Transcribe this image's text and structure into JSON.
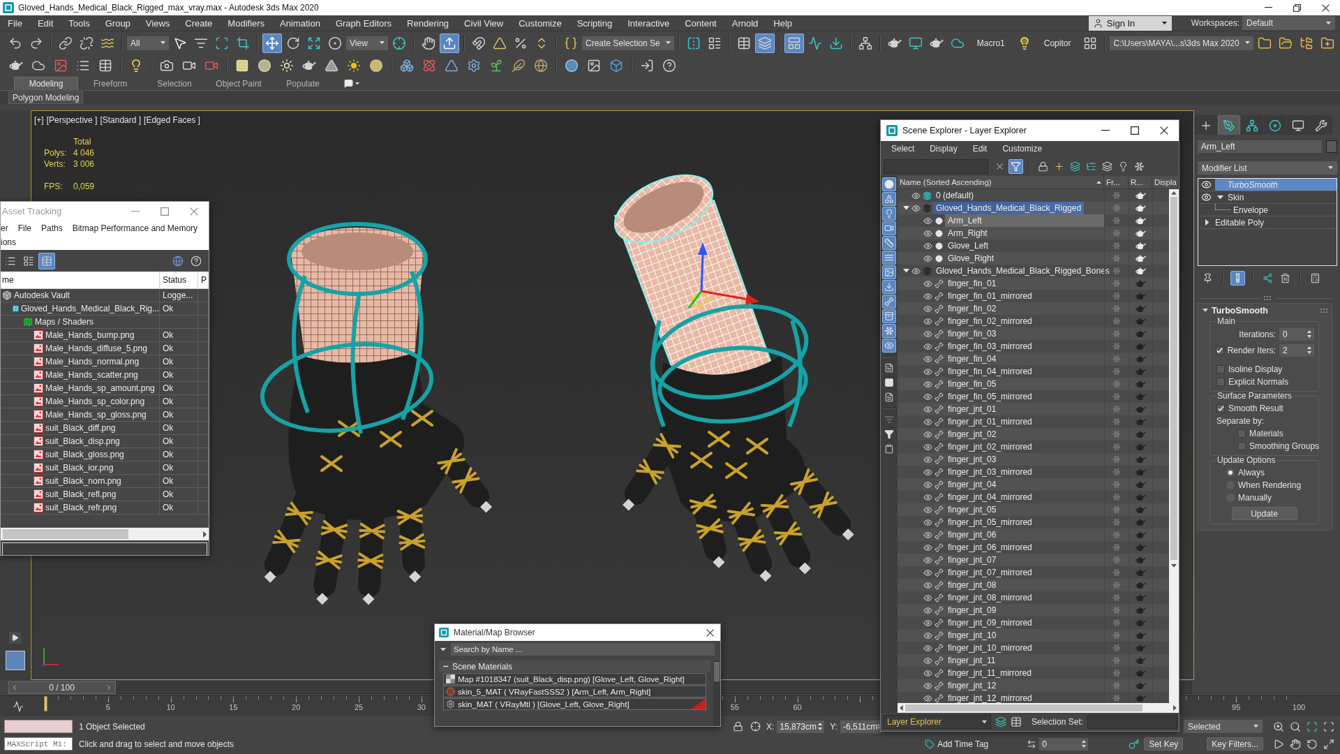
{
  "window": {
    "title": "Gloved_Hands_Medical_Black_Rigged_max_vray.max - Autodesk 3ds Max 2020"
  },
  "menu": [
    "File",
    "Edit",
    "Tools",
    "Group",
    "Views",
    "Create",
    "Modifiers",
    "Animation",
    "Graph Editors",
    "Rendering",
    "Civil View",
    "Customize",
    "Scripting",
    "Interactive",
    "Content",
    "Arnold",
    "Help"
  ],
  "account": {
    "sign_in": "Sign In",
    "workspaces_label": "Workspaces:",
    "workspace": "Default"
  },
  "main_toolbar": [
    [
      {
        "kind": "undo",
        "on": false
      },
      {
        "kind": "redo",
        "on": false
      }
    ],
    [
      {
        "kind": "link",
        "on": false
      },
      {
        "kind": "unlink",
        "on": false
      },
      {
        "kind": "bind",
        "on": false
      }
    ],
    [
      {
        "kind": "dropdown",
        "value": "All"
      },
      {
        "kind": "select",
        "on": false
      },
      {
        "kind": "byname",
        "on": false
      },
      {
        "kind": "region",
        "on": false
      },
      {
        "kind": "crossing",
        "on": false
      }
    ],
    [
      {
        "kind": "move",
        "on": true
      },
      {
        "kind": "rotate",
        "on": false
      },
      {
        "kind": "scale",
        "on": false
      },
      {
        "kind": "place",
        "on": false
      },
      {
        "kind": "dropdown",
        "value": "View"
      },
      {
        "kind": "pivot",
        "on": false
      }
    ],
    [
      {
        "kind": "manipulate",
        "on": false
      },
      {
        "kind": "override",
        "on": true
      }
    ],
    [
      {
        "kind": "snap",
        "on": false
      },
      {
        "kind": "angle",
        "on": false
      },
      {
        "kind": "percent",
        "on": false
      },
      {
        "kind": "spinner",
        "on": false
      }
    ],
    [
      {
        "kind": "named",
        "on": false
      },
      {
        "kind": "dropdown",
        "value": "Create Selection Se"
      }
    ],
    [
      {
        "kind": "mirror",
        "on": false
      },
      {
        "kind": "align",
        "on": false
      }
    ],
    [
      {
        "kind": "explorer",
        "on": false
      },
      {
        "kind": "layers",
        "on": true
      }
    ],
    [
      {
        "kind": "ribbon",
        "on": true
      },
      {
        "kind": "curves",
        "on": false
      },
      {
        "kind": "schematic",
        "on": false
      }
    ],
    [
      {
        "kind": "nodes",
        "on": false
      }
    ],
    [
      {
        "kind": "setup",
        "on": false
      },
      {
        "kind": "framewindow",
        "on": false
      },
      {
        "kind": "render",
        "on": false
      },
      {
        "kind": "cloudrender",
        "on": false
      },
      {
        "kind": "label",
        "text": "Macro1"
      },
      {
        "kind": "bulb",
        "on": false
      },
      {
        "kind": "label",
        "text": "Copitor"
      },
      {
        "kind": "grid",
        "on": false
      }
    ],
    [
      {
        "kind": "dropdown",
        "value": "C:\\Users\\MAYA\\...s\\3ds Max 2020"
      },
      {
        "kind": "project",
        "on": false
      },
      {
        "kind": "projectopen",
        "on": false
      },
      {
        "kind": "projecttree",
        "on": false
      },
      {
        "kind": "projectadd",
        "on": false
      }
    ]
  ],
  "secondary_toolbar": [
    [
      {
        "kind": "teapot",
        "on": false
      },
      {
        "kind": "cloud",
        "on": false
      },
      {
        "kind": "imagewindow",
        "on": false
      },
      {
        "kind": "list",
        "on": false
      },
      {
        "kind": "table",
        "on": false
      }
    ],
    [
      {
        "kind": "lightsign",
        "on": false
      }
    ],
    [
      {
        "kind": "camera",
        "on": false
      },
      {
        "kind": "video",
        "on": false
      },
      {
        "kind": "redcamera",
        "on": false
      }
    ],
    [
      {
        "kind": "plane",
        "on": false
      },
      {
        "kind": "dome",
        "on": false
      },
      {
        "kind": "glow",
        "on": false
      },
      {
        "kind": "teapot",
        "on": false
      },
      {
        "kind": "cone",
        "on": false
      },
      {
        "kind": "sun",
        "on": false
      },
      {
        "kind": "sphere",
        "on": false
      }
    ],
    [
      {
        "kind": "cubes",
        "on": false
      },
      {
        "kind": "molecule",
        "on": false
      },
      {
        "kind": "pyramid",
        "on": false
      },
      {
        "kind": "blob",
        "on": false
      },
      {
        "kind": "grass",
        "on": false
      },
      {
        "kind": "hair",
        "on": false
      },
      {
        "kind": "fur",
        "on": false
      }
    ],
    [
      {
        "kind": "ball",
        "on": false
      },
      {
        "kind": "renderimage",
        "on": false
      },
      {
        "kind": "cube",
        "on": false
      }
    ],
    [
      {
        "kind": "device",
        "on": false
      },
      {
        "kind": "help",
        "on": false
      }
    ]
  ],
  "ribbon": {
    "tabs": [
      {
        "label": "Modeling",
        "selected": true
      },
      {
        "label": "Freeform",
        "selected": false
      },
      {
        "label": "Selection",
        "selected": false
      },
      {
        "label": "Object Paint",
        "selected": false
      },
      {
        "label": "Populate",
        "selected": false
      }
    ],
    "panel": "Polygon Modeling"
  },
  "viewport": {
    "labels": [
      "[+]",
      "[Perspective ]",
      "[Standard ]",
      "[Edged Faces ]"
    ],
    "stats": {
      "heading": "Total",
      "rows": [
        {
          "kind": "count",
          "label": "Polys:",
          "value": "4 046"
        },
        {
          "kind": "count",
          "label": "Verts:",
          "value": "3 006"
        },
        {
          "kind": "rate",
          "label": "FPS:",
          "value": "0,059"
        }
      ]
    }
  },
  "asset_tracking": {
    "title": "Asset Tracking",
    "menu": [
      "er",
      "File",
      "Paths",
      "Bitmap Performance and Memory",
      "ions"
    ],
    "toolbar": [
      [
        {
          "kind": "list",
          "on": false
        },
        {
          "kind": "thumbnails",
          "on": false
        },
        {
          "kind": "table",
          "on": true
        }
      ],
      [
        {
          "kind": "globehelp",
          "on": false
        },
        {
          "kind": "help",
          "on": false
        }
      ]
    ],
    "columns": [
      "me",
      "Status",
      "P"
    ],
    "tree": [
      {
        "name": "Autodesk Vault",
        "kind": "vault",
        "status": "Logge...",
        "children": [
          {
            "name": "Gloved_Hands_Medical_Black_Rig...",
            "kind": "scene",
            "status": "Ok",
            "children": [
              {
                "name": "Maps / Shaders",
                "kind": "folder",
                "children": [
                  {
                    "name": "Male_Hands_bump.png",
                    "kind": "bitmap",
                    "status": "Ok"
                  },
                  {
                    "name": "Male_Hands_diffuse_5.png",
                    "kind": "bitmap",
                    "status": "Ok"
                  },
                  {
                    "name": "Male_Hands_normal.png",
                    "kind": "bitmap",
                    "status": "Ok"
                  },
                  {
                    "name": "Male_Hands_scatter.png",
                    "kind": "bitmap",
                    "status": "Ok"
                  },
                  {
                    "name": "Male_Hands_sp_amount.png",
                    "kind": "bitmap",
                    "status": "Ok"
                  },
                  {
                    "name": "Male_Hands_sp_color.png",
                    "kind": "bitmap",
                    "status": "Ok"
                  },
                  {
                    "name": "Male_Hands_sp_gloss.png",
                    "kind": "bitmap",
                    "status": "Ok"
                  },
                  {
                    "name": "suit_Black_diff.png",
                    "kind": "bitmap",
                    "status": "Ok"
                  },
                  {
                    "name": "suit_Black_disp.png",
                    "kind": "bitmap",
                    "status": "Ok"
                  },
                  {
                    "name": "suit_Black_gloss.png",
                    "kind": "bitmap",
                    "status": "Ok"
                  },
                  {
                    "name": "suit_Black_ior.png",
                    "kind": "bitmap",
                    "status": "Ok"
                  },
                  {
                    "name": "suit_Black_norn.png",
                    "kind": "bitmap",
                    "status": "Ok"
                  },
                  {
                    "name": "suit_Black_refl.png",
                    "kind": "bitmap",
                    "status": "Ok"
                  },
                  {
                    "name": "suit_Black_refr.png",
                    "kind": "bitmap",
                    "status": "Ok"
                  }
                ]
              }
            ]
          }
        ]
      }
    ]
  },
  "scene_explorer": {
    "title": "Scene Explorer - Layer Explorer",
    "menu": [
      "Select",
      "Display",
      "Edit",
      "Customize"
    ],
    "toolbar": [
      [
        {
          "kind": "clear",
          "on": false
        },
        {
          "kind": "filter",
          "on": true
        }
      ],
      [
        {
          "kind": "lock",
          "on": false
        },
        {
          "kind": "addlayer",
          "on": false
        },
        {
          "kind": "stack",
          "on": false
        },
        {
          "kind": "tree",
          "on": false
        },
        {
          "kind": "layerlist",
          "on": false
        },
        {
          "kind": "lightlayer",
          "on": false
        },
        {
          "kind": "freezelayer",
          "on": false
        }
      ]
    ],
    "filters": [
      [
        {
          "kind": "geometry",
          "on": true
        },
        {
          "kind": "shapes",
          "on": true
        },
        {
          "kind": "lights",
          "on": true
        },
        {
          "kind": "cameras",
          "on": true
        },
        {
          "kind": "helpers",
          "on": true
        },
        {
          "kind": "spacewarps",
          "on": true
        },
        {
          "kind": "groups",
          "on": true
        },
        {
          "kind": "xrefs",
          "on": true
        },
        {
          "kind": "bones",
          "on": true
        },
        {
          "kind": "containers",
          "on": true
        },
        {
          "kind": "frozen",
          "on": true
        },
        {
          "kind": "hidden",
          "on": true
        }
      ],
      [
        {
          "kind": "details",
          "on": false
        },
        {
          "kind": "blank",
          "on": false
        },
        {
          "kind": "notes",
          "on": false
        }
      ],
      [
        {
          "kind": "filterset",
          "on": false
        },
        {
          "kind": "funnel",
          "on": false
        },
        {
          "kind": "clipboard",
          "on": false
        }
      ]
    ],
    "columns": [
      "Name (Sorted Ascending)",
      "Fr...",
      "R...",
      "Displa"
    ],
    "layers": [
      {
        "name": "0 (default)",
        "active": true,
        "expanded": false,
        "selected": false,
        "renderable": true
      },
      {
        "name": "Gloved_Hands_Medical_Black_Rigged",
        "active": false,
        "expanded": true,
        "selected": true,
        "renderable": true,
        "children": [
          {
            "name": "Arm_Left",
            "kind": "geometry",
            "selected": true,
            "renderable": true
          },
          {
            "name": "Arm_Right",
            "kind": "geometry",
            "selected": false,
            "renderable": true
          },
          {
            "name": "Glove_Left",
            "kind": "geometry",
            "selected": false,
            "renderable": true
          },
          {
            "name": "Glove_Right",
            "kind": "geometry",
            "selected": false,
            "renderable": true
          }
        ]
      },
      {
        "name": "Gloved_Hands_Medical_Black_Rigged_Bones",
        "active": false,
        "expanded": true,
        "selected": false,
        "renderable": true,
        "children": [
          {
            "name": "finger_fin_01",
            "kind": "bone",
            "selected": false,
            "renderable": false
          },
          {
            "name": "finger_fin_01_mirrored",
            "kind": "bone",
            "selected": false,
            "renderable": false
          },
          {
            "name": "finger_fin_02",
            "kind": "bone",
            "selected": false,
            "renderable": false
          },
          {
            "name": "finger_fin_02_mirrored",
            "kind": "bone",
            "selected": false,
            "renderable": false
          },
          {
            "name": "finger_fin_03",
            "kind": "bone",
            "selected": false,
            "renderable": false
          },
          {
            "name": "finger_fin_03_mirrored",
            "kind": "bone",
            "selected": false,
            "renderable": false
          },
          {
            "name": "finger_fin_04",
            "kind": "bone",
            "selected": false,
            "renderable": false
          },
          {
            "name": "finger_fin_04_mirrored",
            "kind": "bone",
            "selected": false,
            "renderable": false
          },
          {
            "name": "finger_fin_05",
            "kind": "bone",
            "selected": false,
            "renderable": false
          },
          {
            "name": "finger_fin_05_mirrored",
            "kind": "bone",
            "selected": false,
            "renderable": false
          },
          {
            "name": "finger_jnt_01",
            "kind": "bone",
            "selected": false,
            "renderable": false
          },
          {
            "name": "finger_jnt_01_mirrored",
            "kind": "bone",
            "selected": false,
            "renderable": false
          },
          {
            "name": "finger_jnt_02",
            "kind": "bone",
            "selected": false,
            "renderable": false
          },
          {
            "name": "finger_jnt_02_mirrored",
            "kind": "bone",
            "selected": false,
            "renderable": false
          },
          {
            "name": "finger_jnt_03",
            "kind": "bone",
            "selected": false,
            "renderable": false
          },
          {
            "name": "finger_jnt_03_mirrored",
            "kind": "bone",
            "selected": false,
            "renderable": false
          },
          {
            "name": "finger_jnt_04",
            "kind": "bone",
            "selected": false,
            "renderable": false
          },
          {
            "name": "finger_jnt_04_mirrored",
            "kind": "bone",
            "selected": false,
            "renderable": false
          },
          {
            "name": "finger_jnt_05",
            "kind": "bone",
            "selected": false,
            "renderable": false
          },
          {
            "name": "finger_jnt_05_mirrored",
            "kind": "bone",
            "selected": false,
            "renderable": false
          },
          {
            "name": "finger_jnt_06",
            "kind": "bone",
            "selected": false,
            "renderable": false
          },
          {
            "name": "finger_jnt_06_mirrored",
            "kind": "bone",
            "selected": false,
            "renderable": false
          },
          {
            "name": "finger_jnt_07",
            "kind": "bone",
            "selected": false,
            "renderable": false
          },
          {
            "name": "finger_jnt_07_mirrored",
            "kind": "bone",
            "selected": false,
            "renderable": false
          },
          {
            "name": "finger_jnt_08",
            "kind": "bone",
            "selected": false,
            "renderable": false
          },
          {
            "name": "finger_jnt_08_mirrored",
            "kind": "bone",
            "selected": false,
            "renderable": false
          },
          {
            "name": "finger_jnt_09",
            "kind": "bone",
            "selected": false,
            "renderable": false
          },
          {
            "name": "finger_jnt_09_mirrored",
            "kind": "bone",
            "selected": false,
            "renderable": false
          },
          {
            "name": "finger_jnt_10",
            "kind": "bone",
            "selected": false,
            "renderable": false
          },
          {
            "name": "finger_jnt_10_mirrored",
            "kind": "bone",
            "selected": false,
            "renderable": false
          },
          {
            "name": "finger_jnt_11",
            "kind": "bone",
            "selected": false,
            "renderable": false
          },
          {
            "name": "finger_jnt_11_mirrored",
            "kind": "bone",
            "selected": false,
            "renderable": false
          },
          {
            "name": "finger_jnt_12",
            "kind": "bone",
            "selected": false,
            "renderable": false
          },
          {
            "name": "finger_jnt_12_mirrored",
            "kind": "bone",
            "selected": false,
            "renderable": false
          }
        ]
      }
    ],
    "footer": {
      "mode": "Layer Explorer",
      "selection_label": "Selection Set:"
    }
  },
  "material_browser": {
    "title": "Material/Map Browser",
    "search": {
      "placeholder": "Search by Name ..."
    },
    "group": {
      "label": "Scene Materials",
      "expanded": true,
      "items": [
        {
          "name": "Map #1018347 (suit_Black_disp.png) [Glove_Left, Glove_Right]",
          "kind": "map",
          "selected": false,
          "marked": false
        },
        {
          "name": "skin_5_MAT ( VRayFastSSS2 ) [Arm_Left, Arm_Right]",
          "kind": "material",
          "selected": false,
          "marked": false
        },
        {
          "name": "skin_MAT ( VRayMtl ) [Glove_Left, Glove_Right]",
          "kind": "vraymtl",
          "selected": false,
          "marked": true
        }
      ]
    }
  },
  "command_panel": {
    "tabs": [
      {
        "kind": "create",
        "selected": false
      },
      {
        "kind": "modify",
        "selected": true
      },
      {
        "kind": "hierarchy",
        "selected": false
      },
      {
        "kind": "motion",
        "selected": false
      },
      {
        "kind": "display",
        "selected": false
      },
      {
        "kind": "utilities",
        "selected": false
      }
    ],
    "object_name": "Arm_Left",
    "modifier_list": "Modifier List",
    "stack": [
      {
        "name": "TurboSmooth",
        "kind": "modifier",
        "selected": true
      },
      {
        "name": "Skin",
        "kind": "modifier",
        "selected": false,
        "expanded": true,
        "children": [
          {
            "name": "Envelope",
            "kind": "subobject",
            "selected": false
          }
        ]
      },
      {
        "name": "Editable Poly",
        "kind": "base",
        "selected": false,
        "expanded": false
      }
    ],
    "stack_tools": [
      [
        {
          "kind": "pin",
          "on": false
        }
      ],
      [
        {
          "kind": "endresult",
          "on": true
        }
      ],
      [
        {
          "kind": "unique",
          "on": false
        },
        {
          "kind": "remove",
          "on": false
        }
      ],
      [
        {
          "kind": "configure",
          "on": false
        }
      ]
    ],
    "rollout": {
      "title": "TurboSmooth",
      "expanded": true,
      "groups": [
        {
          "label": "Main",
          "controls": [
            {
              "kind": "spinner",
              "label": "Iterations:",
              "value": "0"
            },
            {
              "kind": "checkspinner",
              "label": "Render Iters:",
              "checked": true,
              "value": "2"
            },
            {
              "kind": "checkbox",
              "label": "Isoline Display",
              "checked": false
            },
            {
              "kind": "checkbox",
              "label": "Explicit Normals",
              "checked": false
            }
          ]
        },
        {
          "label": "Surface Parameters",
          "controls": [
            {
              "kind": "checkbox",
              "label": "Smooth Result",
              "checked": true
            },
            {
              "kind": "label",
              "label": "Separate by:",
              "children": [
                {
                  "kind": "checkbox",
                  "label": "Materials",
                  "checked": false
                },
                {
                  "kind": "checkbox",
                  "label": "Smoothing Groups",
                  "checked": false
                }
              ]
            }
          ]
        },
        {
          "label": "Update Options",
          "controls": [
            {
              "kind": "radio",
              "label": "Always",
              "selected": true
            },
            {
              "kind": "radio",
              "label": "When Rendering",
              "selected": false
            },
            {
              "kind": "radio",
              "label": "Manually",
              "selected": false
            },
            {
              "kind": "button",
              "label": "Update"
            }
          ]
        }
      ]
    }
  },
  "time_slider": {
    "label": "0 / 100",
    "level": 0
  },
  "track_bar": {
    "frames": [
      "5",
      "10",
      "15",
      "20",
      "25",
      "30",
      "55",
      "60",
      "95",
      "100"
    ]
  },
  "status_bar": {
    "listener": "MAXScript Mi:",
    "selection": "1 Object Selected",
    "prompt": "Click and drag to select and move objects",
    "coords": [
      {
        "label": "X:",
        "value": "15,873cm"
      },
      {
        "label": "Y:",
        "value": "-6,511cm"
      }
    ],
    "time_tag": "Add Time Tag",
    "frame": "0",
    "key_mode": "Selected",
    "set_key": "Set Key",
    "key_filters": "Key Filters..."
  }
}
